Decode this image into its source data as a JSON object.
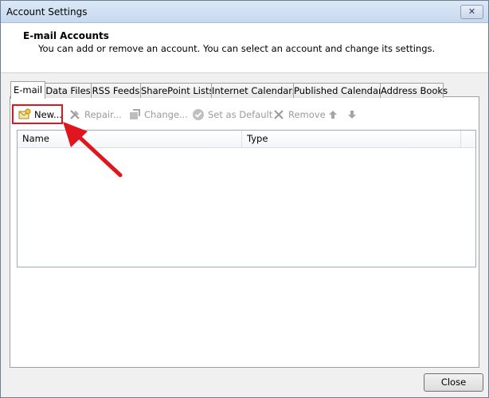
{
  "window": {
    "title": "Account Settings"
  },
  "header": {
    "title": "E-mail Accounts",
    "subtitle": "You can add or remove an account. You can select an account and change its settings."
  },
  "tabs": [
    {
      "label": "E-mail",
      "active": true
    },
    {
      "label": "Data Files"
    },
    {
      "label": "RSS Feeds"
    },
    {
      "label": "SharePoint Lists"
    },
    {
      "label": "Internet Calendars"
    },
    {
      "label": "Published Calendars"
    },
    {
      "label": "Address Books"
    }
  ],
  "toolbar": {
    "new_label": "New...",
    "repair_label": "Repair...",
    "change_label": "Change...",
    "set_default_label": "Set as Default",
    "remove_label": "Remove"
  },
  "list": {
    "columns": [
      "Name",
      "Type"
    ],
    "rows": []
  },
  "footer": {
    "close_label": "Close"
  },
  "colors": {
    "highlight": "#e0161e",
    "arrow": "#e0161e"
  },
  "icons": {
    "new": "new-account-icon",
    "repair": "repair-icon",
    "change": "change-icon",
    "set_default": "checkmark-icon",
    "remove": "remove-x-icon",
    "move_up": "arrow-up-icon",
    "move_down": "arrow-down-icon",
    "close": "close-icon"
  }
}
